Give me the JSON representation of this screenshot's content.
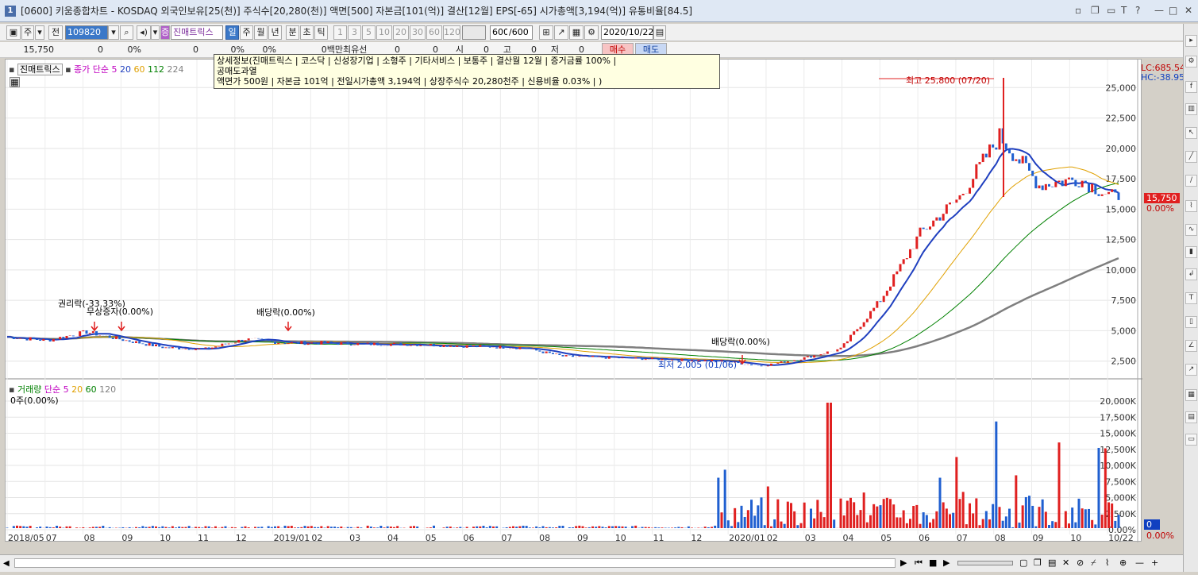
{
  "window": {
    "title": "[0600] 키움종합차트 - KOSDAQ 외국인보유[25(천)] 주식수[20,280(천)] 액면[500] 자본금[101(억)] 결산[12월] EPS[-65] 시가총액[3,194(억)] 유통비율[84.5]",
    "app_number": "1",
    "help_mark": "?"
  },
  "toolbar": {
    "period_week": "주",
    "prev_label": "전",
    "code": "109820",
    "stock_name": "진매트릭스",
    "periods": [
      "일",
      "주",
      "월",
      "년",
      "분",
      "초",
      "틱"
    ],
    "selected_period": "일",
    "intervals": [
      "1",
      "3",
      "5",
      "10",
      "20",
      "30",
      "60",
      "120"
    ],
    "count": "600",
    "count_total": "/600",
    "date": "2020/10/22"
  },
  "quote": {
    "price": "15,750",
    "change": "0",
    "change_pct": "0%",
    "volume": "0",
    "vol_pct": "0%",
    "vol_pct2": "0%",
    "amount": "0백만",
    "best_bid_label": "최유선",
    "v1": "0",
    "v2": "0",
    "open_label": "시",
    "open": "0",
    "high_label": "고",
    "high": "0",
    "low_label": "저",
    "low": "0",
    "buy_button": "매수",
    "sell_button": "매도"
  },
  "tooltip": {
    "line1": "상세정보(진매트릭스 | 코스닥 | 신성장기업 | 소형주 | 기타서비스 | 보통주 | 결산월 12월 | 증거금률 100% |",
    "line2": "공매도과열",
    "line3": "액면가 500원 | 자본금 101억 | 전일시가총액 3,194억 | 상장주식수 20,280천주 | 신용비율 0.03% | )"
  },
  "price_panel": {
    "name": "진매트릭스",
    "ma_label": "종가 단순",
    "ma_periods": [
      "5",
      "20",
      "60",
      "112",
      "224"
    ],
    "ma_colors": [
      "#c000c0",
      "#1f3fbf",
      "#e0a000",
      "#008000",
      "#7f7f7f"
    ],
    "lc_label": "LC:685.54",
    "hc_label": "HC:-38.95",
    "last_price": "15,750",
    "last_pct": "0.00%",
    "high_note": "최고 25,800 (07/20)",
    "low_note": "최저 2,005 (01/06)",
    "events": [
      {
        "label": "권리락(-33.33%)"
      },
      {
        "label": "무상증자(0.00%)"
      },
      {
        "label": "배당락(0.00%)"
      },
      {
        "label": "배당락(0.00%)"
      }
    ],
    "y_ticks": [
      "25,000",
      "22,500",
      "20,000",
      "17,500",
      "15,000",
      "12,500",
      "10,000",
      "7,500",
      "5,000",
      "2,500"
    ]
  },
  "volume_panel": {
    "name": "거래량",
    "ma_label": "단순",
    "ma_periods": [
      "5",
      "20",
      "60",
      "120"
    ],
    "ma_colors": [
      "#c000c0",
      "#e0a000",
      "#008000",
      "#7f7f7f"
    ],
    "current": "0주(0.00%)",
    "last_value": "0",
    "last_pct": "0.00%",
    "y_ticks": [
      "20,000K",
      "17,500K",
      "15,000K",
      "12,500K",
      "10,000K",
      "7,500K",
      "5,000K",
      "2,500K",
      "0.00%"
    ]
  },
  "x_axis": [
    "2018/05",
    "07",
    "08",
    "09",
    "10",
    "11",
    "12",
    "2019/01",
    "02",
    "03",
    "04",
    "05",
    "06",
    "07",
    "08",
    "09",
    "10",
    "11",
    "12",
    "2020/01",
    "02",
    "03",
    "04",
    "05",
    "06",
    "07",
    "08",
    "09",
    "10",
    "10/22"
  ],
  "chart_data": {
    "type": "line",
    "title": "진매트릭스",
    "series": [
      {
        "name": "종가",
        "x": [
          "2018/05",
          "2018/07",
          "2018/08",
          "2018/09",
          "2018/10",
          "2018/11",
          "2018/12",
          "2019/01",
          "2019/02",
          "2019/03",
          "2019/04",
          "2019/05",
          "2019/06",
          "2019/07",
          "2019/08",
          "2019/09",
          "2019/10",
          "2019/11",
          "2019/12",
          "2020/01",
          "2020/02",
          "2020/03",
          "2020/04",
          "2020/05",
          "2020/06",
          "2020/07",
          "2020/08",
          "2020/09",
          "2020/10"
        ],
        "values": [
          4500,
          4200,
          4900,
          4200,
          3600,
          3500,
          4300,
          4000,
          4000,
          3900,
          3900,
          3800,
          3700,
          3600,
          2900,
          2800,
          2700,
          2600,
          2500,
          2100,
          2700,
          3500,
          7500,
          13000,
          16000,
          21000,
          17000,
          17500,
          15750
        ]
      }
    ],
    "ylim": [
      1500,
      26000
    ]
  }
}
